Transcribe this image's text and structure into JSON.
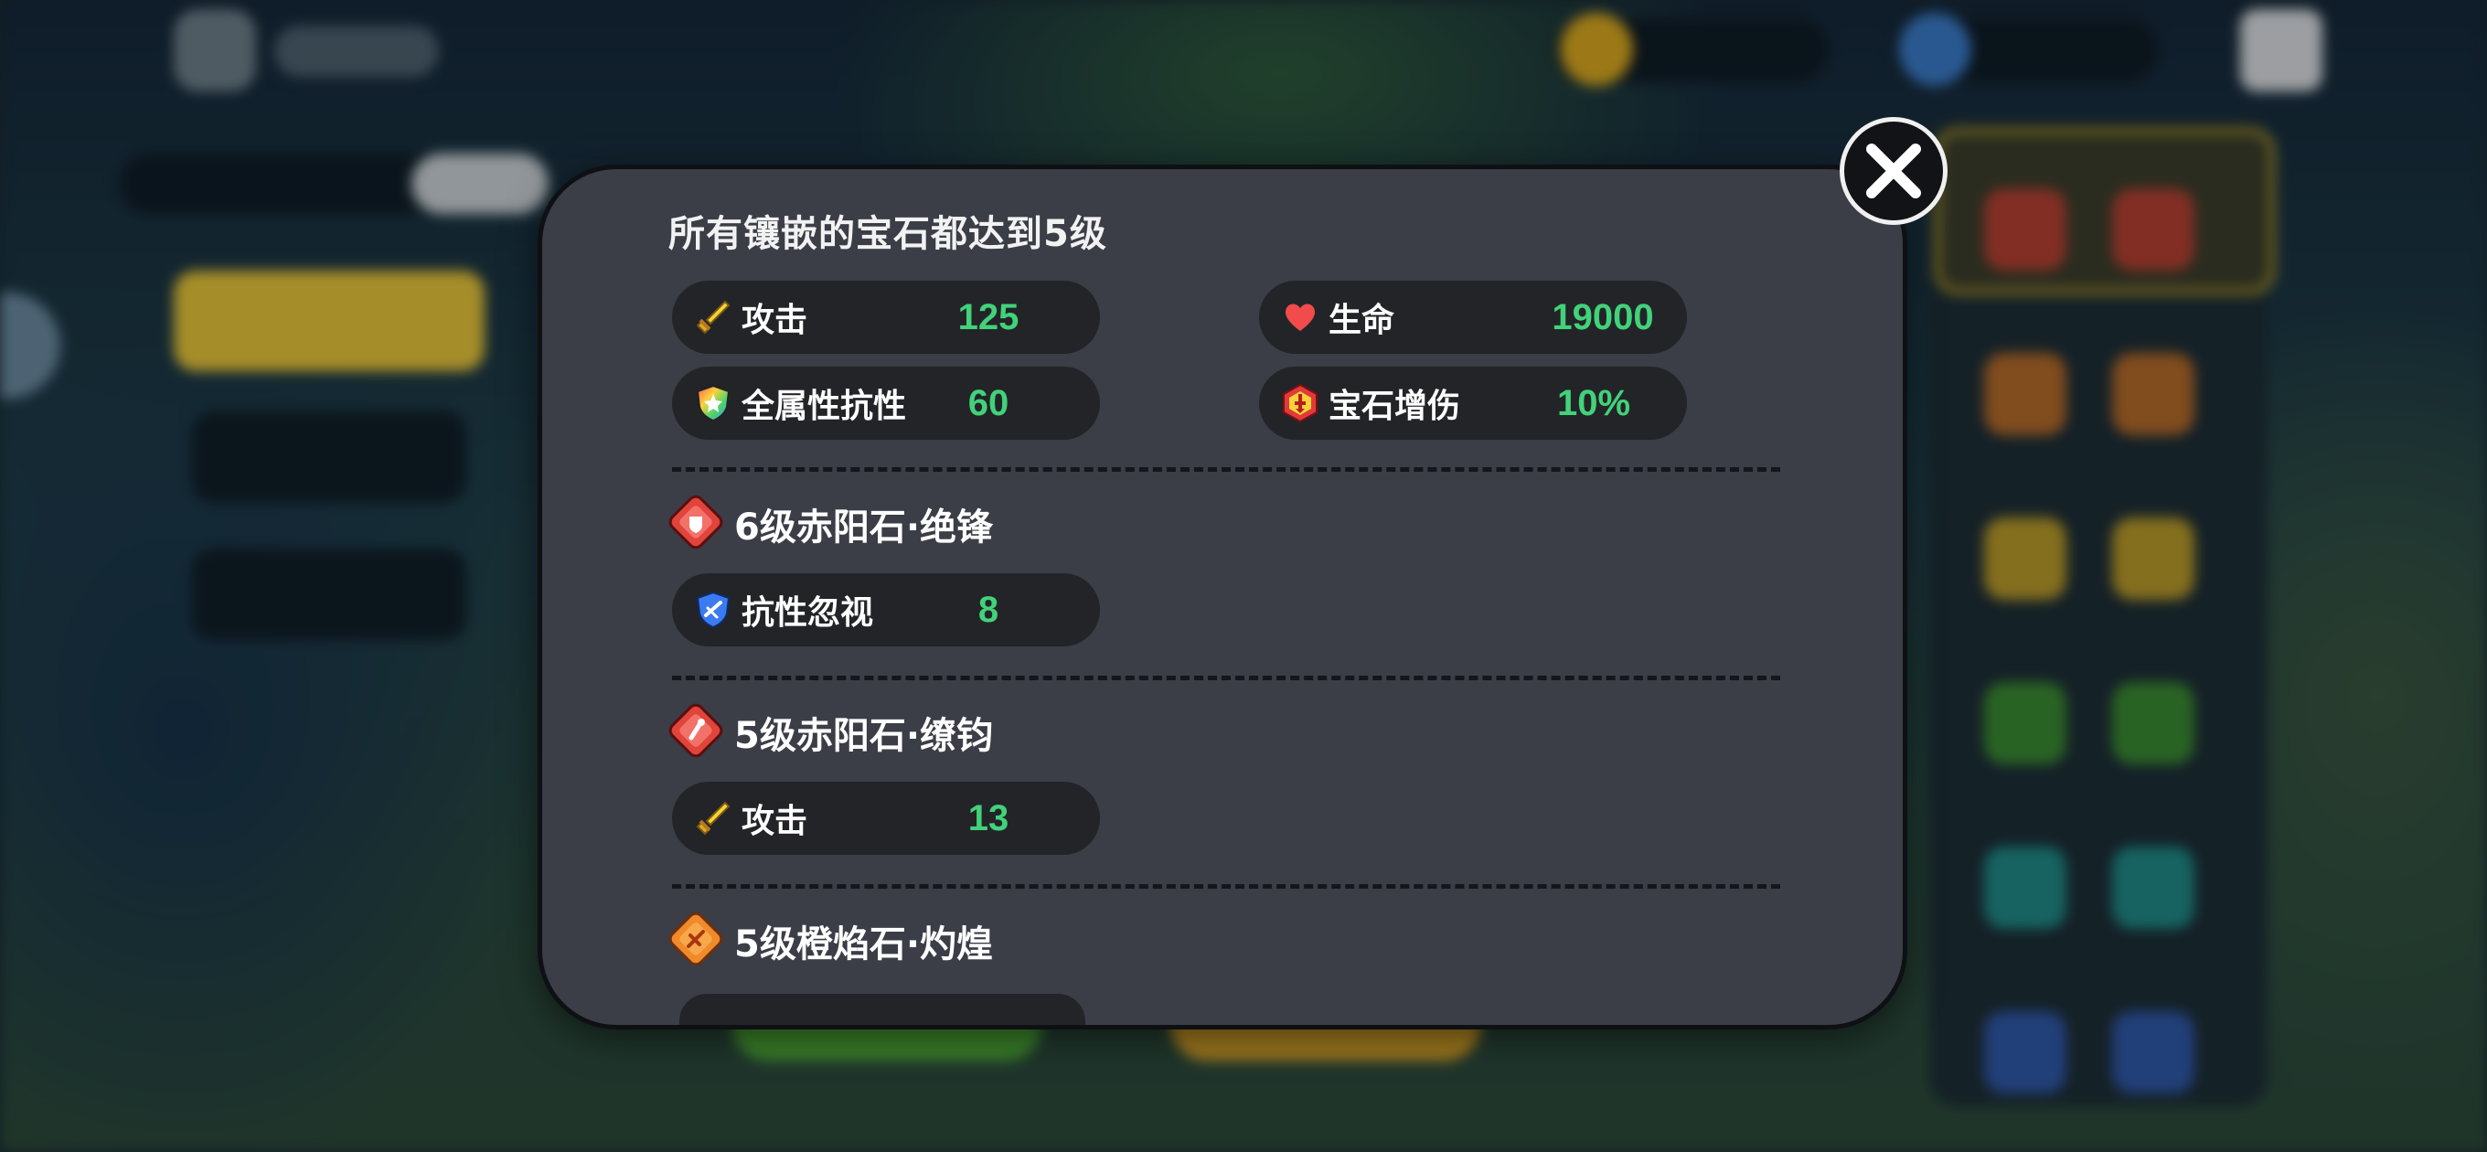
{
  "modal": {
    "title": "所有镶嵌的宝石都达到5级",
    "set_bonus": [
      {
        "label": "攻击",
        "value": "125",
        "icon": "sword-icon"
      },
      {
        "label": "生命",
        "value": "19000",
        "icon": "heart-icon"
      },
      {
        "label": "全属性抗性",
        "value": "60",
        "icon": "rainbow-shield-icon"
      },
      {
        "label": "宝石增伤",
        "value": "10%",
        "icon": "gem-damage-icon"
      }
    ],
    "gems": [
      {
        "name": "6级赤阳石·绝锋",
        "icon": "red-gem-icon",
        "stats": [
          {
            "label": "抗性忽视",
            "value": "8",
            "icon": "blue-shield-icon"
          }
        ]
      },
      {
        "name": "5级赤阳石·缭钧",
        "icon": "red-gem-icon",
        "stats": [
          {
            "label": "攻击",
            "value": "13",
            "icon": "sword-icon"
          }
        ]
      },
      {
        "name": "5级橙焰石·灼煌",
        "icon": "orange-gem-icon",
        "stats": []
      }
    ]
  },
  "colors": {
    "panel": "#3b3d47",
    "stat_pill": "#232428",
    "value_green": "#41d27a",
    "text": "#ffffff"
  }
}
